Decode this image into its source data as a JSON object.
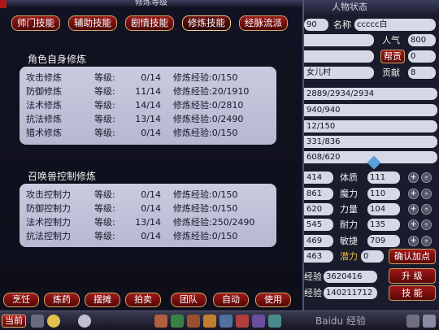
{
  "cultivation_window": {
    "title": "修炼等级",
    "tabs": [
      "师门技能",
      "辅助技能",
      "剧情技能",
      "修炼技能",
      "经脉流派"
    ],
    "active_tab": 3,
    "character_section": {
      "title": "角色自身修炼",
      "rows": [
        {
          "name": "攻击修炼",
          "level_label": "等级:",
          "level": "0/14",
          "exp_label": "修炼经验:",
          "exp": "0/150"
        },
        {
          "name": "防御修炼",
          "level_label": "等级:",
          "level": "11/14",
          "exp_label": "修炼经验:",
          "exp": "20/1910"
        },
        {
          "name": "法术修炼",
          "level_label": "等级:",
          "level": "14/14",
          "exp_label": "修炼经验:",
          "exp": "0/2810"
        },
        {
          "name": "抗法修炼",
          "level_label": "等级:",
          "level": "13/14",
          "exp_label": "修炼经验:",
          "exp": "0/2490"
        },
        {
          "name": "猎术修炼",
          "level_label": "等级:",
          "level": "0/14",
          "exp_label": "修炼经验:",
          "exp": "0/150"
        }
      ]
    },
    "pet_section": {
      "title": "召唤兽控制修炼",
      "rows": [
        {
          "name": "攻击控制力",
          "level_label": "等级:",
          "level": "0/14",
          "exp_label": "修炼经验:",
          "exp": "0/150"
        },
        {
          "name": "防御控制力",
          "level_label": "等级:",
          "level": "0/14",
          "exp_label": "修炼经验:",
          "exp": "0/150"
        },
        {
          "name": "法术控制力",
          "level_label": "等级:",
          "level": "13/14",
          "exp_label": "修炼经验:",
          "exp": "250/2490"
        },
        {
          "name": "抗法控制力",
          "level_label": "等级:",
          "level": "0/14",
          "exp_label": "修炼经验:",
          "exp": "0/150"
        }
      ]
    },
    "toolbar": [
      "烹饪",
      "炼药",
      "摆摊",
      "拍卖",
      "团队",
      "自动",
      "使用"
    ]
  },
  "character_window": {
    "title": "人物状态",
    "id_fragment": "90",
    "name_label": "名称",
    "name_value": "ccccc白",
    "popularity_label": "人气",
    "popularity_value": "800",
    "faction_button": "帮贡",
    "faction_value": "0",
    "sect_value": "女儿村",
    "contribution_label": "贡献",
    "contribution_value": "8",
    "bars": [
      "2889/2934/2934",
      "940/940",
      "12/150",
      "331/836",
      "608/620"
    ],
    "attributes": [
      {
        "left_value": "414",
        "label": "体质",
        "value": "111"
      },
      {
        "left_value": "861",
        "label": "魔力",
        "value": "110"
      },
      {
        "left_value": "620",
        "label": "力量",
        "value": "104"
      },
      {
        "left_value": "545",
        "label": "耐力",
        "value": "135"
      },
      {
        "left_value": "469",
        "label": "敏捷",
        "value": "709"
      }
    ],
    "potential_left": "463",
    "potential_label": "潜力",
    "potential_value": "0",
    "confirm_button": "确认加点",
    "exp_label": "经验",
    "exp_value": "3620416",
    "upgrade_button": "升 级",
    "exp2_label": "经验",
    "exp2_value": "140211712",
    "skill_button": "技 能"
  },
  "taskbar": {
    "current_button": "当前",
    "watermark": "Baidu 经验"
  }
}
